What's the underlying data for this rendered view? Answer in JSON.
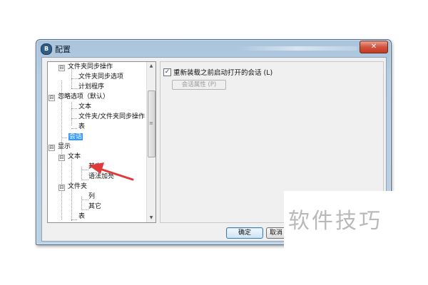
{
  "window": {
    "title": "配置",
    "icon": "app-logo-icon",
    "close_label": "✕"
  },
  "tree": {
    "items": [
      {
        "label": "文件夹同步操作",
        "expander": "⊟"
      },
      {
        "label": "文件夹同步选项"
      },
      {
        "label": "计划程序"
      },
      {
        "label": "忽略选项（默认）",
        "expander": "⊟"
      },
      {
        "label": "文本"
      },
      {
        "label": "文件夹/文件夹同步操作"
      },
      {
        "label": "表"
      },
      {
        "label": "会话",
        "selected": true
      },
      {
        "label": "显示",
        "expander": "⊟"
      },
      {
        "label": "文本",
        "expander": "⊟"
      },
      {
        "label": "其它"
      },
      {
        "label": "语法加亮"
      },
      {
        "label": "文件夹",
        "expander": "⊟"
      },
      {
        "label": "列"
      },
      {
        "label": "其它"
      },
      {
        "label": "表"
      }
    ],
    "scroll_up": "▲",
    "scroll_down": "▼",
    "scroll_grip": "≡"
  },
  "settings": {
    "reopen_checkbox_label": "重新装载之前启动打开的会话 (L)",
    "reopen_checked": true,
    "check_mark": "✓",
    "session_props_label": "会话属性 (P)"
  },
  "buttons": {
    "ok": "确定",
    "cancel": "取消"
  },
  "watermark": "软件技巧",
  "colors": {
    "selection": "#3399ff",
    "arrow": "#e03a3a",
    "title_bar": "#b7cde2"
  }
}
